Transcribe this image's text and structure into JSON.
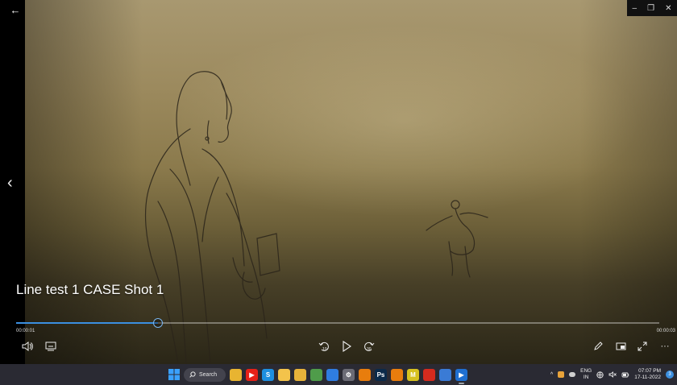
{
  "player": {
    "back_glyph": "←",
    "window_controls": {
      "minimize": "–",
      "restore": "❐",
      "close": "✕"
    },
    "prev_glyph": "‹",
    "title": "Line test 1 CASE Shot 1",
    "progress": 0.22,
    "elapsed": "00:00:01",
    "duration": "00:00:03",
    "controls": {
      "volume_icon": "volume-icon",
      "subtitles_icon": "subtitles-icon",
      "skip_back_label": "10",
      "skip_forward_label": "30",
      "edit_icon": "pencil-icon",
      "miniplayer_icon": "miniplayer-icon",
      "fullscreen_icon": "fullscreen-icon",
      "more_label": "···"
    },
    "colors": {
      "accent": "#3b8fe0"
    }
  },
  "taskbar": {
    "search_label": "Search",
    "apps": [
      {
        "name": "file-explorer",
        "glyph": "",
        "color": "#e8b431"
      },
      {
        "name": "youtube",
        "glyph": "▶",
        "color": "#e62117"
      },
      {
        "name": "skype",
        "glyph": "S",
        "color": "#1d8fe0"
      },
      {
        "name": "folder",
        "glyph": "",
        "color": "#f3c34b"
      },
      {
        "name": "chrome",
        "glyph": "",
        "color": "#e8b33a"
      },
      {
        "name": "chrome-profile-2",
        "glyph": "",
        "color": "#4f9c4a"
      },
      {
        "name": "chrome-profile-3",
        "glyph": "",
        "color": "#2f7de1"
      },
      {
        "name": "settings",
        "glyph": "⚙",
        "color": "#6b6b75"
      },
      {
        "name": "blender",
        "glyph": "",
        "color": "#e87d0d"
      },
      {
        "name": "photoshop",
        "glyph": "Ps",
        "color": "#0b2a4a"
      },
      {
        "name": "blender-2",
        "glyph": "",
        "color": "#e87d0d"
      },
      {
        "name": "app-m",
        "glyph": "M",
        "color": "#d6c120"
      },
      {
        "name": "acrobat",
        "glyph": "",
        "color": "#d52b1e"
      },
      {
        "name": "photos",
        "glyph": "",
        "color": "#3a7bd5"
      },
      {
        "name": "media-player",
        "glyph": "▶",
        "color": "#1f6fd1"
      }
    ],
    "tray": {
      "chevron": "^",
      "lang_top": "ENG",
      "lang_bottom": "IN",
      "time": "07:07 PM",
      "date": "17-11-2022",
      "notification_count": "3"
    }
  }
}
